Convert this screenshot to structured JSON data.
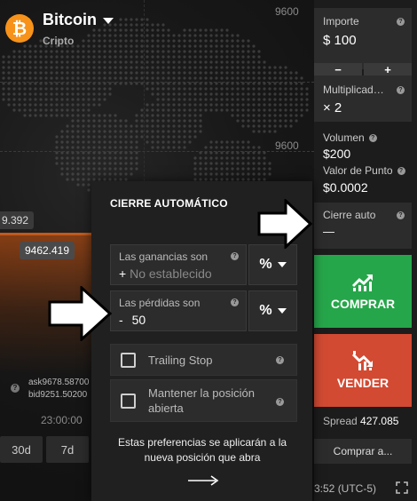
{
  "asset": {
    "name": "Bitcoin",
    "type": "Cripto",
    "logo_icon": "bitcoin-icon",
    "logo_glyph": "₿",
    "logo_color": "#f7931a"
  },
  "chart": {
    "price_levels": [
      "9600",
      "9600"
    ],
    "left_price": "9.392",
    "current_price": "9462.419",
    "ask": "ask9678.58700",
    "bid": "bid9251.50200",
    "time_label": "23:00:00",
    "timeframes": [
      "30d",
      "7d"
    ]
  },
  "right_panel": {
    "importe": {
      "label": "Importe",
      "value": "$ 100",
      "minus": "−",
      "plus": "+"
    },
    "multiplicador": {
      "label": "Multiplicad…",
      "value": "× 2"
    },
    "volumen": {
      "label": "Volumen",
      "value": "$200"
    },
    "valor_punto": {
      "label": "Valor de Punto",
      "value": "$0.0002"
    },
    "cierre_auto": {
      "label": "Cierre auto",
      "value": "—"
    },
    "buy": {
      "label": "COMPRAR",
      "color": "#26a64a",
      "icon": "chart-up-icon"
    },
    "sell": {
      "label": "VENDER",
      "color": "#d24a32",
      "icon": "chart-down-icon"
    },
    "spread": {
      "label": "Spread",
      "value": "427.085"
    },
    "buy_at": "Comprar a...",
    "clock": "3:52 (UTC-5)"
  },
  "autoclose": {
    "title": "CIERRE AUTOMÁTICO",
    "gains": {
      "label": "Las ganancias son",
      "sign": "+",
      "placeholder": "No establecido",
      "unit": "%"
    },
    "losses": {
      "label": "Las pérdidas son",
      "sign": "-",
      "value": "50",
      "unit": "%"
    },
    "trailing_stop": {
      "label": "Trailing Stop",
      "checked": false
    },
    "keep_position": {
      "label_line1": "Mantener la posición",
      "label_line2": "abierta",
      "checked": false
    },
    "note": "Estas preferencias se aplicarán a la nueva posición que abra"
  }
}
